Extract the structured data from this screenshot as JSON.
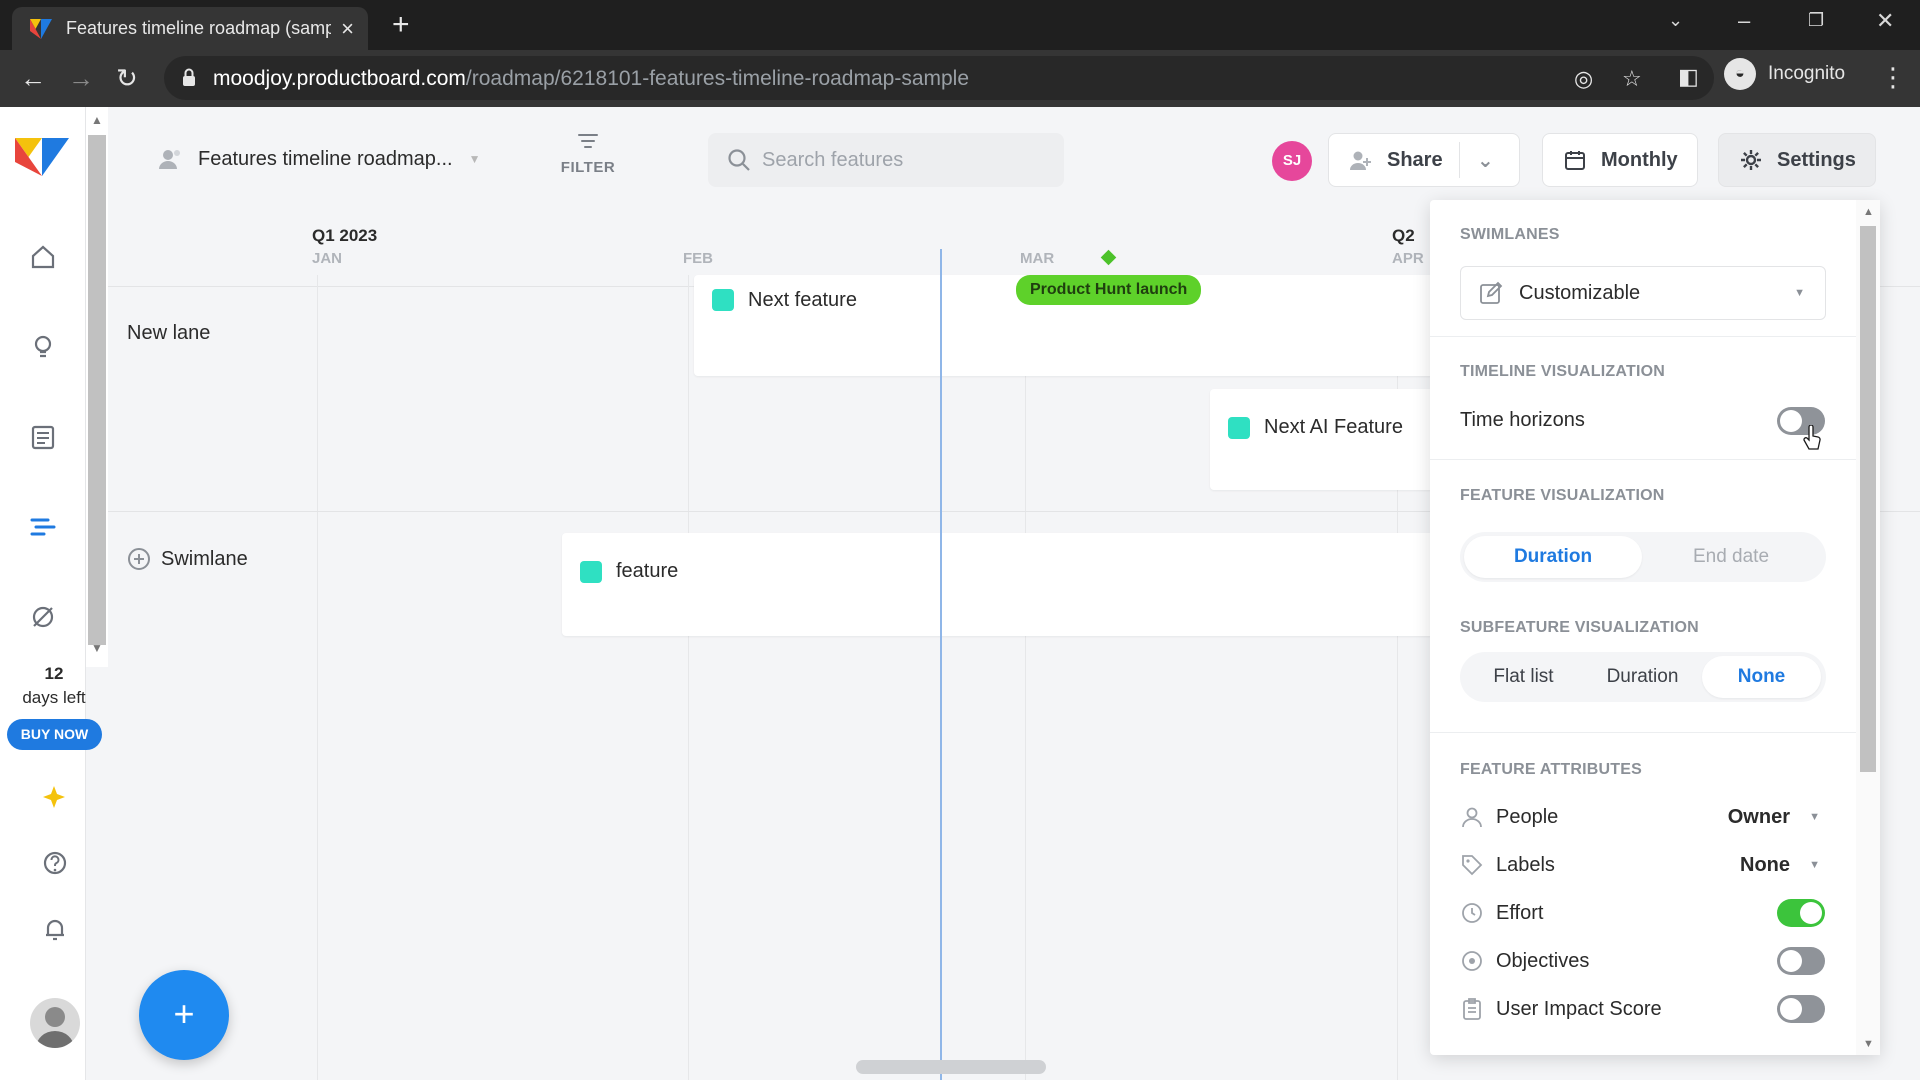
{
  "browser": {
    "tab_title": "Features timeline roadmap (samp",
    "url_host": "moodjoy.productboard.com",
    "url_path": "/roadmap/6218101-features-timeline-roadmap-sample",
    "profile_label": "Incognito"
  },
  "sidebar": {
    "trial_days": "12",
    "trial_suffix": "days left",
    "buy_now": "BUY NOW"
  },
  "toolbar": {
    "roadmap_title": "Features timeline roadmap...",
    "filter_label": "FILTER",
    "search_placeholder": "Search features",
    "user_initials": "SJ",
    "share_label": "Share",
    "zoom_label": "Monthly",
    "settings_label": "Settings"
  },
  "timeline": {
    "quarters": [
      "Q1 2023",
      "Q2"
    ],
    "months": [
      "JAN",
      "FEB",
      "MAR",
      "APR"
    ],
    "milestone": "Product Hunt launch",
    "lanes": [
      {
        "name": "New lane"
      },
      {
        "name": "Swimlane"
      }
    ],
    "features": [
      {
        "name": "Next feature"
      },
      {
        "name": "Next AI Feature"
      },
      {
        "name": "feature"
      }
    ]
  },
  "settings": {
    "swimlanes_heading": "SWIMLANES",
    "swimlanes_value": "Customizable",
    "timeline_heading": "TIMELINE VISUALIZATION",
    "time_horizons_label": "Time horizons",
    "time_horizons_on": false,
    "feature_vis_heading": "FEATURE VISUALIZATION",
    "feature_vis_options": [
      "Duration",
      "End date"
    ],
    "feature_vis_selected": "Duration",
    "subfeature_heading": "SUBFEATURE VISUALIZATION",
    "subfeature_options": [
      "Flat list",
      "Duration",
      "None"
    ],
    "subfeature_selected": "None",
    "attributes_heading": "FEATURE ATTRIBUTES",
    "attributes": [
      {
        "label": "People",
        "value": "Owner",
        "icon": "person-icon"
      },
      {
        "label": "Labels",
        "value": "None",
        "icon": "tag-icon"
      },
      {
        "label": "Effort",
        "toggle": true,
        "icon": "clock-icon"
      },
      {
        "label": "Objectives",
        "toggle": false,
        "icon": "target-icon"
      },
      {
        "label": "User Impact Score",
        "toggle": false,
        "icon": "clipboard-icon"
      }
    ]
  },
  "colors": {
    "accent": "#1f7ae0",
    "feature_teal": "#2fe0c2",
    "milestone_green": "#5ed12a",
    "toggle_on": "#3cc43c",
    "avatar_pink": "#e6479b"
  }
}
